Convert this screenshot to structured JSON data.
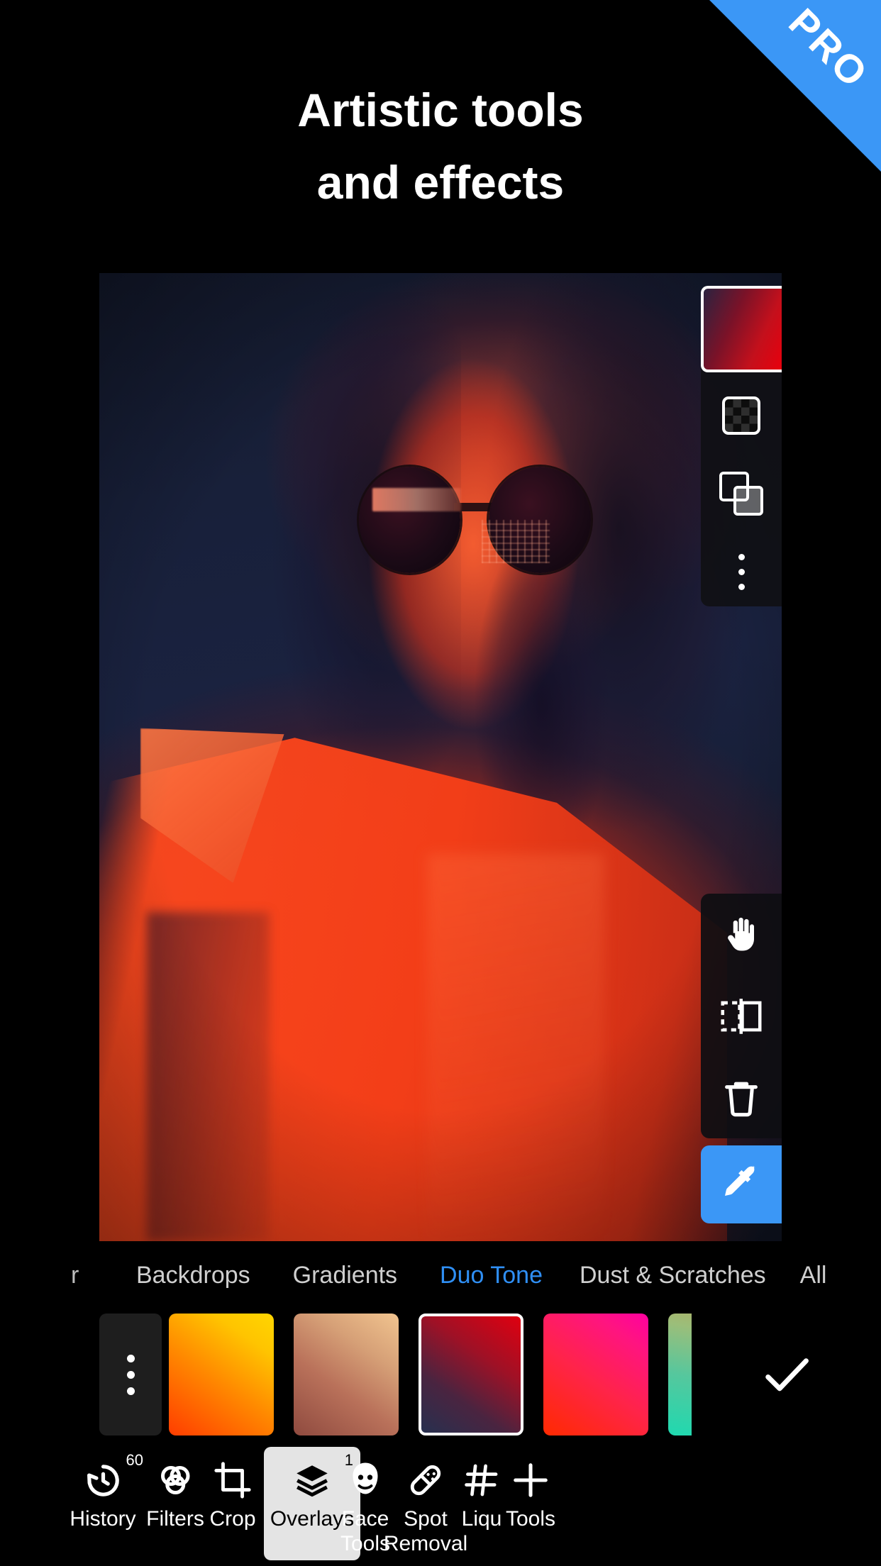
{
  "badge": {
    "label": "PRO",
    "color": "#3b97f6"
  },
  "headline": {
    "line1": "Artistic tools",
    "line2": "and effects"
  },
  "accent_color": "#2f8ff5",
  "canvas": {
    "name": "photo-editor-canvas",
    "description": "Portrait of a woman wearing round sunglasses, duo tone red and navy effect applied"
  },
  "layer_panel": {
    "thumbnail_gradient": "#2b2340 to #e8000d",
    "buttons": [
      {
        "name": "transparency-icon",
        "label": "Transparency"
      },
      {
        "name": "blend-mode-icon",
        "label": "Blend Mode"
      },
      {
        "name": "more-options-icon",
        "label": "More"
      }
    ]
  },
  "tool_panel": {
    "buttons": [
      {
        "name": "pan-hand-icon",
        "label": "Pan"
      },
      {
        "name": "flip-mirror-icon",
        "label": "Flip"
      },
      {
        "name": "delete-trash-icon",
        "label": "Delete"
      }
    ],
    "eyedropper": {
      "name": "eyedropper-icon",
      "label": "Eyedropper",
      "color": "#3b97f6"
    }
  },
  "tabs": [
    {
      "label": "r",
      "active": false,
      "clipped": true
    },
    {
      "label": "Backdrops",
      "active": false
    },
    {
      "label": "Gradients",
      "active": false
    },
    {
      "label": "Duo Tone",
      "active": true
    },
    {
      "label": "Dust & Scratches",
      "active": false
    },
    {
      "label": "All",
      "active": false
    }
  ],
  "presets": [
    {
      "name": "preset-more",
      "type": "more",
      "selected": false
    },
    {
      "name": "preset-orange-yellow",
      "gradient": "linear-gradient(35deg,#ff3d00 0%,#ff8a00 46%,#ffc400 78%,#ffd600 100%)",
      "selected": false
    },
    {
      "name": "preset-copper-tan",
      "gradient": "linear-gradient(35deg,#8f4a3f 0%,#b9715a 40%,#d6a077 70%,#f1c48f 100%)",
      "selected": false
    },
    {
      "name": "preset-red-navy",
      "gradient": "linear-gradient(35deg,#27304f 0%,#4a2440 32%,#9e1126 64%,#e00010 100%)",
      "selected": true
    },
    {
      "name": "preset-red-pink",
      "gradient": "linear-gradient(35deg,#ff2a00 0%,#ff2448 45%,#ff1480 80%,#ff00a0 100%)",
      "selected": false
    },
    {
      "name": "preset-teal-olive",
      "gradient": "linear-gradient(10deg,#1fd9b0 0%,#56c79d 45%,#9bbe7a 80%,#b0ad62 100%)",
      "selected": false
    }
  ],
  "confirm": {
    "name": "confirm-checkmark",
    "label": "Apply"
  },
  "bottom_tools": [
    {
      "name": "history",
      "label": "History",
      "icon": "history-icon",
      "badge": "60",
      "selected": false
    },
    {
      "name": "filters",
      "label": "Filters",
      "icon": "filters-icon",
      "badge": "",
      "selected": false
    },
    {
      "name": "crop",
      "label": "Crop",
      "icon": "crop-icon",
      "badge": "",
      "selected": false
    },
    {
      "name": "overlays",
      "label": "Overlays",
      "icon": "overlays-icon",
      "badge": "1",
      "selected": true
    },
    {
      "name": "face-tools",
      "label": "Face\nTools",
      "icon": "face-tools-icon",
      "badge": "",
      "selected": false
    },
    {
      "name": "spot-removal",
      "label": "Spot\nRemoval",
      "icon": "spot-removal-icon",
      "badge": "",
      "selected": false
    },
    {
      "name": "liquify",
      "label": "Liqu",
      "icon": "liquify-icon",
      "badge": "",
      "selected": false
    },
    {
      "name": "tools",
      "label": "Tools",
      "icon": "plus-icon",
      "badge": "",
      "selected": false
    }
  ]
}
